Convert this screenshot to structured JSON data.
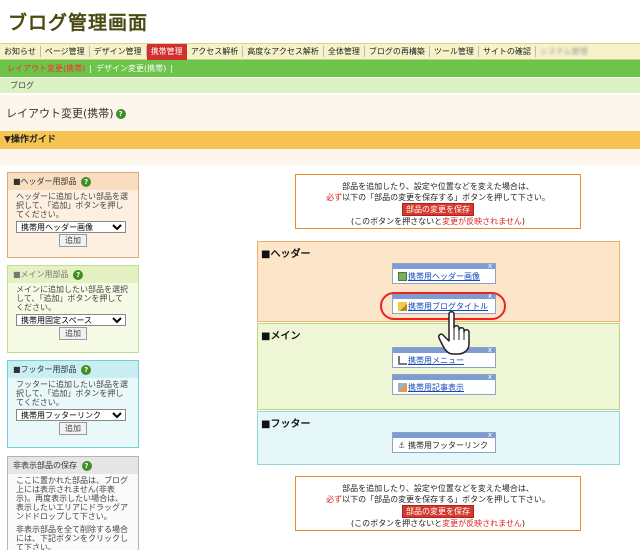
{
  "app": {
    "title": "ブログ管理画面"
  },
  "menu": [
    {
      "label": "お知らせ"
    },
    {
      "label": "ページ管理"
    },
    {
      "label": "デザイン管理"
    },
    {
      "label": "携帯管理"
    },
    {
      "label": "アクセス解析"
    },
    {
      "label": "高度なアクセス解析"
    },
    {
      "label": "全体管理"
    },
    {
      "label": "ブログの再構築"
    },
    {
      "label": "ツール管理"
    },
    {
      "label": "サイトの確認"
    },
    {
      "label": "システム管理"
    }
  ],
  "submenu": {
    "active": "レイアウト変更(携帯)",
    "sep": "|",
    "other": "デザイン変更(携帯)"
  },
  "breadcrumb": "ブログ",
  "page": {
    "title": "レイアウト変更(携帯)",
    "help": "?"
  },
  "guide": {
    "label": "▼操作ガイド"
  },
  "panels": {
    "header": {
      "title": "■ヘッダー用部品",
      "desc": "ヘッダーに追加したい部品を選択して、「追加」ボタンを押してください。",
      "selected": "携帯用ヘッダー画像",
      "add": "追加"
    },
    "main": {
      "title": "■メイン用部品",
      "desc": "メインに追加したい部品を選択して、「追加」ボタンを押してください。",
      "selected": "携帯用固定スペース",
      "add": "追加"
    },
    "footer": {
      "title": "■フッター用部品",
      "desc": "フッターに追加したい部品を選択して、「追加」ボタンを押してください。",
      "selected": "携帯用フッターリンク",
      "add": "追加"
    },
    "hidden": {
      "title": "非表示部品の保存",
      "desc1": "ここに置かれた部品は、ブログ上には表示されません(非表示)。再度表示したい場合は、表示したいエリアにドラッグアンドドロップして下さい。",
      "desc2": "非表示部品を全て削除する場合には、下記ボタンをクリックして下さい。"
    }
  },
  "savebox": {
    "line1": "部品を追加したり、設定や位置などを変えた場合は、",
    "line2_red": "必ず",
    "line2_rest": "以下の「部品の変更を保存する」ボタンを押して下さい。",
    "button": "部品の変更を保存",
    "line3_pre": "(このボタンを押さないと",
    "line3_red": "変更が反映されません",
    "line3_post": ")"
  },
  "zones": {
    "header": {
      "title": "■ヘッダー",
      "parts": [
        "携帯用ヘッダー画像",
        "携帯用ブログタイトル"
      ]
    },
    "main": {
      "title": "■メイン",
      "parts": [
        "携帯用メニュー",
        "携帯用記事表示"
      ]
    },
    "footer": {
      "title": "■フッター",
      "parts": [
        "携帯用フッターリンク"
      ]
    }
  },
  "close_mark": "x",
  "colors": {
    "header_accent": "#f7c451",
    "submenu_green": "#6cc44b",
    "active_tab": "#d22f2f",
    "highlight_ring": "#e22222"
  }
}
